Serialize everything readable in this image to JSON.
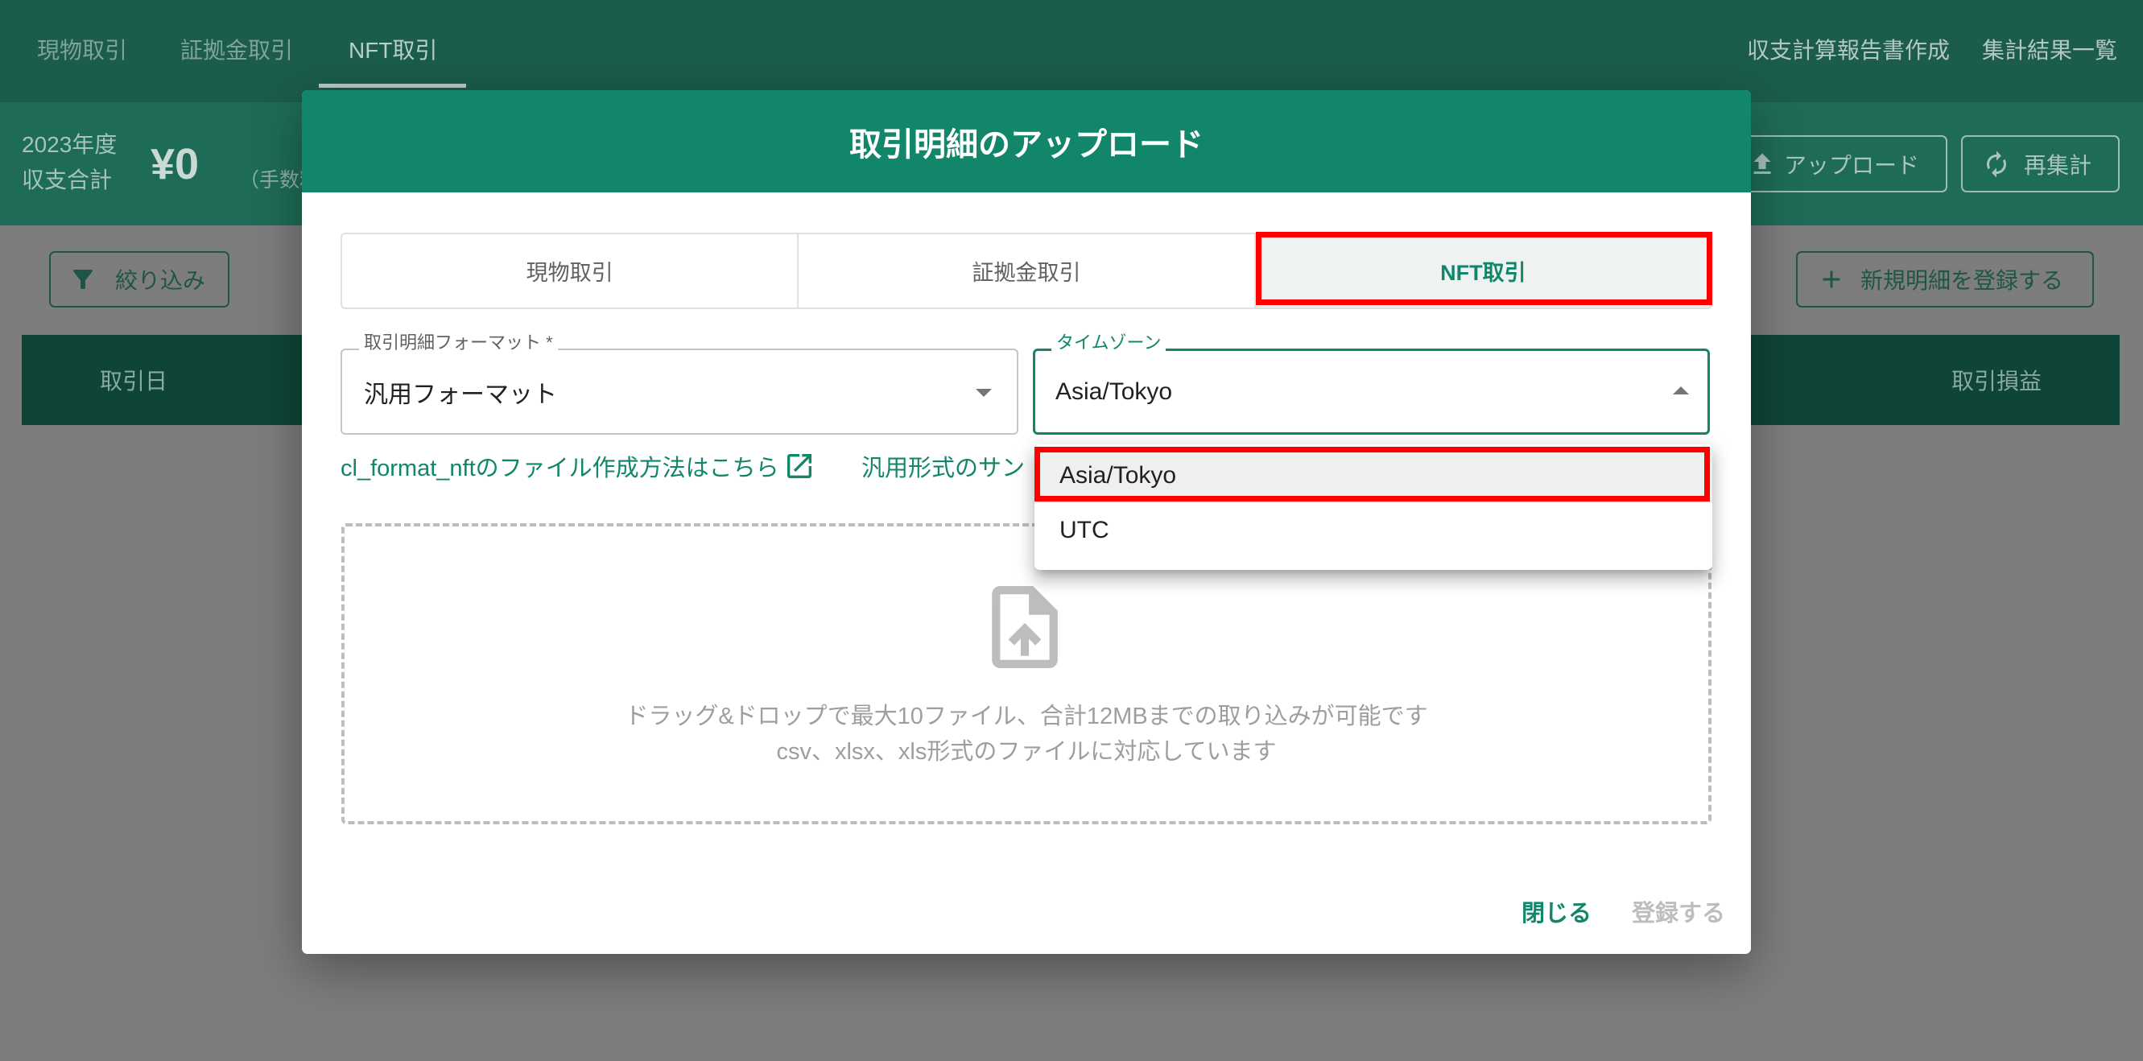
{
  "colors": {
    "primary": "#12866a",
    "nav-bg": "#1b5c4b",
    "band-bg": "#1e6c57",
    "table-header-bg": "#0f4538",
    "page-bg": "#7d7d7d",
    "highlight": "#ff0000"
  },
  "nav": {
    "tabs": [
      {
        "label": "現物取引",
        "active": false
      },
      {
        "label": "証拠金取引",
        "active": false
      },
      {
        "label": "NFT取引",
        "active": true
      }
    ],
    "right_links": [
      "収支計算報告書作成",
      "集計結果一覧"
    ]
  },
  "summary": {
    "year": "2023年度",
    "total_label": "収支合計",
    "total_value": "¥0",
    "fee_note": "（手数料",
    "upload_button": "アップロード",
    "recalc_button": "再集計"
  },
  "toolbar": {
    "filter_button": "絞り込み",
    "add_button": "新規明細を登録する"
  },
  "table": {
    "columns": [
      "取引日",
      "取引損益"
    ]
  },
  "modal": {
    "title": "取引明細のアップロード",
    "tabs": [
      {
        "label": "現物取引",
        "active": false
      },
      {
        "label": "証拠金取引",
        "active": false
      },
      {
        "label": "NFT取引",
        "active": true
      }
    ],
    "format_field": {
      "label": "取引明細フォーマット *",
      "value": "汎用フォーマット"
    },
    "timezone_field": {
      "label": "タイムゾーン",
      "value": "Asia/Tokyo",
      "options": [
        {
          "label": "Asia/Tokyo",
          "selected": true
        },
        {
          "label": "UTC",
          "selected": false
        }
      ]
    },
    "links": {
      "howto": "cl_format_nftのファイル作成方法はこちら",
      "sample": "汎用形式のサン"
    },
    "dropzone": {
      "line1": "ドラッグ&ドロップで最大10ファイル、合計12MBまでの取り込みが可能です",
      "line2": "csv、xlsx、xls形式のファイルに対応しています"
    },
    "footer": {
      "close": "閉じる",
      "submit": "登録する",
      "submit_disabled": true
    }
  },
  "icons": {
    "upload": "upload-icon",
    "recalc": "sync-icon",
    "filter": "filter-icon",
    "add": "plus-icon",
    "format_dropdown": "arrow-drop-down-icon",
    "timezone_dropdown": "arrow-drop-up-icon",
    "external_link": "open-in-new-icon",
    "dropzone": "file-upload-icon"
  }
}
